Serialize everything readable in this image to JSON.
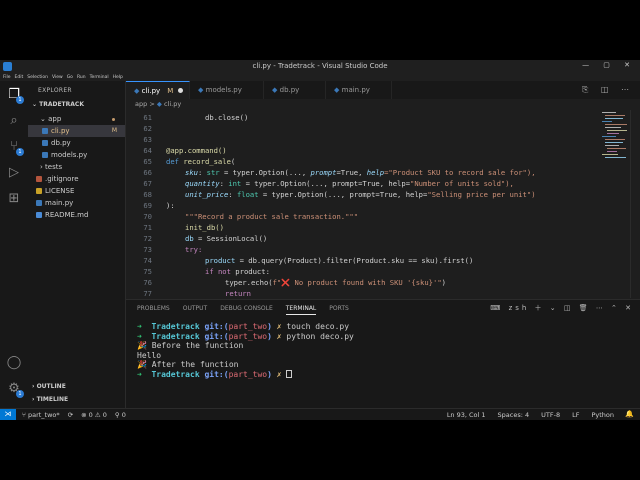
{
  "window": {
    "title": "cli.py - Tradetrack - Visual Studio Code"
  },
  "menu": [
    "File",
    "Edit",
    "Selection",
    "View",
    "Go",
    "Run",
    "Terminal",
    "Help"
  ],
  "sidebar": {
    "header": "EXPLORER",
    "root": "TRADETRACK",
    "items": [
      {
        "label": "app",
        "status": ""
      },
      {
        "label": "cli.py",
        "status": "M"
      },
      {
        "label": "db.py",
        "status": ""
      },
      {
        "label": "models.py",
        "status": ""
      },
      {
        "label": "tests",
        "status": ""
      },
      {
        "label": ".gitignore",
        "status": ""
      },
      {
        "label": "LICENSE",
        "status": ""
      },
      {
        "label": "main.py",
        "status": ""
      },
      {
        "label": "README.md",
        "status": ""
      }
    ],
    "outline": "OUTLINE",
    "timeline": "TIMELINE"
  },
  "tabs": [
    {
      "label": "cli.py",
      "status": "M"
    },
    {
      "label": "models.py"
    },
    {
      "label": "db.py"
    },
    {
      "label": "main.py"
    }
  ],
  "breadcrumb": {
    "folder": "app",
    "sep": ">",
    "file": "cli.py"
  },
  "editor": {
    "lines": [
      "61",
      "62",
      "63",
      "64",
      "65",
      "66",
      "67",
      "68",
      "69",
      "70",
      "71",
      "72",
      "73",
      "74",
      "75",
      "76",
      "77"
    ],
    "code": {
      "l61": "db.close()",
      "l64_dec": "@app.command()",
      "l65_kw": "def",
      "l65_fn": "record_sale",
      "l66_p": "sku",
      "l66_rest1": ": ",
      "l66_ty": "str",
      "l66_rest2": " = typer.Option(..., ",
      "l66_k1": "prompt",
      "l66_v1": "=True, ",
      "l66_k2": "help",
      "l66_s": "=\"Product SKU to record sale for\"),",
      "l67_p": "quantity",
      "l67_ty": "int",
      "l67_rest": " = typer.Option(..., prompt=True, help=",
      "l67_s": "\"Number of units sold\"),",
      "l68_p": "unit_price",
      "l68_ty": "float",
      "l68_rest": " = typer.Option(..., prompt=True, help=",
      "l68_s": "\"Selling price per unit\")",
      "l69": "):",
      "l70": "\"\"\"Record a product sale transaction.\"\"\"",
      "l71": "init_db()",
      "l72_a": "db",
      "l72_b": " = SessionLocal()",
      "l73": "try:",
      "l74_a": "product",
      "l74_b": " = db.query(Product).filter(Product.sku == sku).first()",
      "l75_a": "if not",
      "l75_b": " product:",
      "l76_a": "typer.echo(",
      "l76_s": "f\"❌ No product found with SKU '{sku}'\"",
      "l76_b": ")",
      "l77": "return"
    }
  },
  "panel": {
    "tabs": [
      "PROBLEMS",
      "OUTPUT",
      "DEBUG CONSOLE",
      "TERMINAL",
      "PORTS"
    ],
    "shell": "zsh",
    "terminal": {
      "arrow": "➜",
      "dir": "Tradetrack",
      "git": "git:(",
      "branch": "part_two",
      "git_close": ")",
      "x": "✗",
      "cmd1": "touch deco.py",
      "cmd2": "python deco.py",
      "out1": "🎉 Before the function",
      "out2": "Hello",
      "out3": "🎉 After the function"
    }
  },
  "status": {
    "branch": "part_two*",
    "errors": "0",
    "warnings": "0",
    "ports": "0",
    "position": "Ln 93, Col 1",
    "spaces": "Spaces: 4",
    "encoding": "UTF-8",
    "eol": "LF",
    "language": "Python"
  }
}
